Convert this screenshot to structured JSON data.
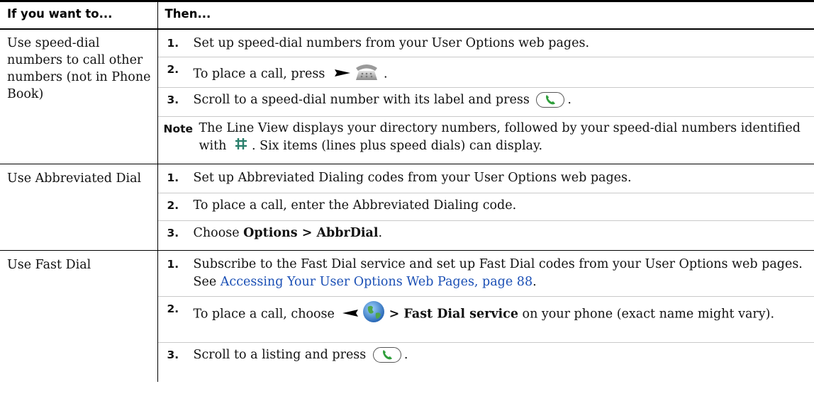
{
  "header": {
    "col1": "If you want to...",
    "col2": "Then..."
  },
  "rows": [
    {
      "task": "Use speed-dial numbers to call other numbers (not in Phone Book)",
      "steps": [
        {
          "num": "1.",
          "text": "Set up speed-dial numbers from your User Options web pages."
        },
        {
          "num": "2.",
          "pre": "To place a call, press",
          "post": "."
        },
        {
          "num": "3.",
          "pre": "Scroll to a speed-dial number with its label and press",
          "post": "."
        }
      ],
      "note": {
        "label": "Note",
        "pre": "The Line View displays your directory numbers, followed by your speed-dial numbers identified with",
        "post": ". Six items (lines plus speed dials) can display."
      }
    },
    {
      "task": "Use Abbreviated Dial",
      "steps": [
        {
          "num": "1.",
          "text": "Set up Abbreviated Dialing codes from your User Options web pages."
        },
        {
          "num": "2.",
          "text": "To place a call, enter the Abbreviated Dialing code."
        },
        {
          "num": "3.",
          "pre": "Choose",
          "bold": "Options > AbbrDial",
          "post": "."
        }
      ]
    },
    {
      "task": "Use Fast Dial",
      "steps": [
        {
          "num": "1.",
          "pre": "Subscribe to the Fast Dial service and set up Fast Dial codes from your User Options web pages. See",
          "link": "Accessing Your User Options Web Pages, page 88",
          "post": "."
        },
        {
          "num": "2.",
          "pre": "To place a call, choose",
          "bold": "> Fast Dial service",
          "post": "on your phone (exact name might vary)."
        },
        {
          "num": "3.",
          "pre": "Scroll to a listing and press",
          "post": "."
        }
      ]
    }
  ],
  "icons": {
    "arrow_right": "right-arrow-icon",
    "phone": "phone-icon",
    "call_button": "call-softkey-icon",
    "speed_dial": "speed-dial-grid-icon",
    "arrow_left": "left-arrow-icon",
    "globe": "globe-services-icon"
  },
  "colors": {
    "link": "#1a4fb5",
    "call_green": "#2e9e3a"
  }
}
